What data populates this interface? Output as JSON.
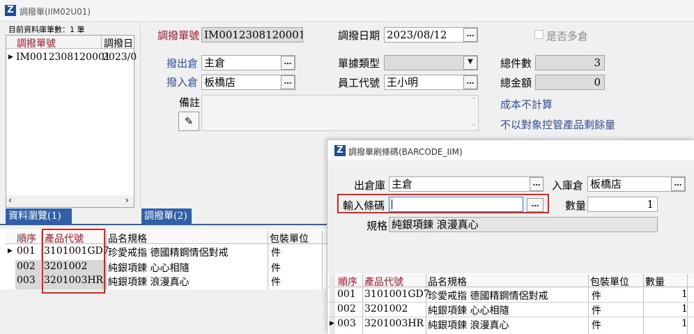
{
  "main_window": {
    "title": "調撥單(IIM02U01)",
    "record_count": "目前資料庫筆數：1 筆",
    "browse": {
      "columns": [
        "調撥單號",
        "調撥日"
      ],
      "rows": [
        {
          "no": "IM0012308120001",
          "date": "2023/0"
        }
      ]
    },
    "tabs": {
      "browse": "資料瀏覽(1)",
      "transfer": "調撥單(2)"
    },
    "form": {
      "no_label": "調撥單號",
      "no_value": "IM0012308120001",
      "date_label": "調撥日期",
      "date_value": "2023/08/12",
      "multi_wh_label": "是否多倉",
      "out_wh_label": "撥出倉",
      "out_wh_value": "主倉",
      "in_wh_label": "撥入倉",
      "in_wh_value": "板橋店",
      "doc_type_label": "單據類型",
      "doc_type_value": "",
      "emp_label": "員工代號",
      "emp_value": "王小明",
      "total_qty_label": "總件數",
      "total_qty_value": "3",
      "total_amt_label": "總金額",
      "total_amt_value": "0",
      "note_label": "備註",
      "note_value": "",
      "cost_text": "成本不計算",
      "stock_text": "不以對象控管產品剩餘量"
    },
    "detail": {
      "columns": [
        "順序",
        "產品代號",
        "品名規格",
        "包裝單位"
      ],
      "rows": [
        {
          "seq": "001",
          "code": "3101001GD7",
          "name": "珍愛戒指 德國精鋼情侶對戒",
          "unit": "件"
        },
        {
          "seq": "002",
          "code": "3201002",
          "name": "純銀項鍊 心心相隨",
          "unit": "件"
        },
        {
          "seq": "003",
          "code": "3201003HR",
          "name": "純銀項鍊 浪漫真心",
          "unit": "件"
        }
      ]
    }
  },
  "barcode_dialog": {
    "title": "調撥單刷條碼(BARCODE_IIM)",
    "out_wh_label": "出倉庫",
    "out_wh_value": "主倉",
    "in_wh_label": "入庫倉",
    "in_wh_value": "板橋店",
    "barcode_label": "輸入條碼",
    "barcode_value": "",
    "qty_label": "數量",
    "qty_value": "1",
    "spec_label": "規格",
    "spec_value": "純銀項鍊 浪漫真心",
    "columns": [
      "順序",
      "產品代號",
      "品名規格",
      "包裝單位",
      "數量"
    ],
    "rows": [
      {
        "seq": "001",
        "code": "3101001GD7",
        "name": "珍愛戒指 德國精鋼情侶對戒",
        "unit": "件",
        "qty": "1"
      },
      {
        "seq": "002",
        "code": "3201002",
        "name": "純銀項鍊 心心相隨",
        "unit": "件",
        "qty": "1"
      },
      {
        "seq": "003",
        "code": "3201003HR",
        "name": "純銀項鍊 浪漫真心",
        "unit": "件",
        "qty": "1"
      }
    ]
  },
  "colors": {
    "highlight": "#e02020",
    "tab_blue": "#2f5fa8",
    "label_red": "#a0162a",
    "label_blue": "#2e4f9a"
  }
}
